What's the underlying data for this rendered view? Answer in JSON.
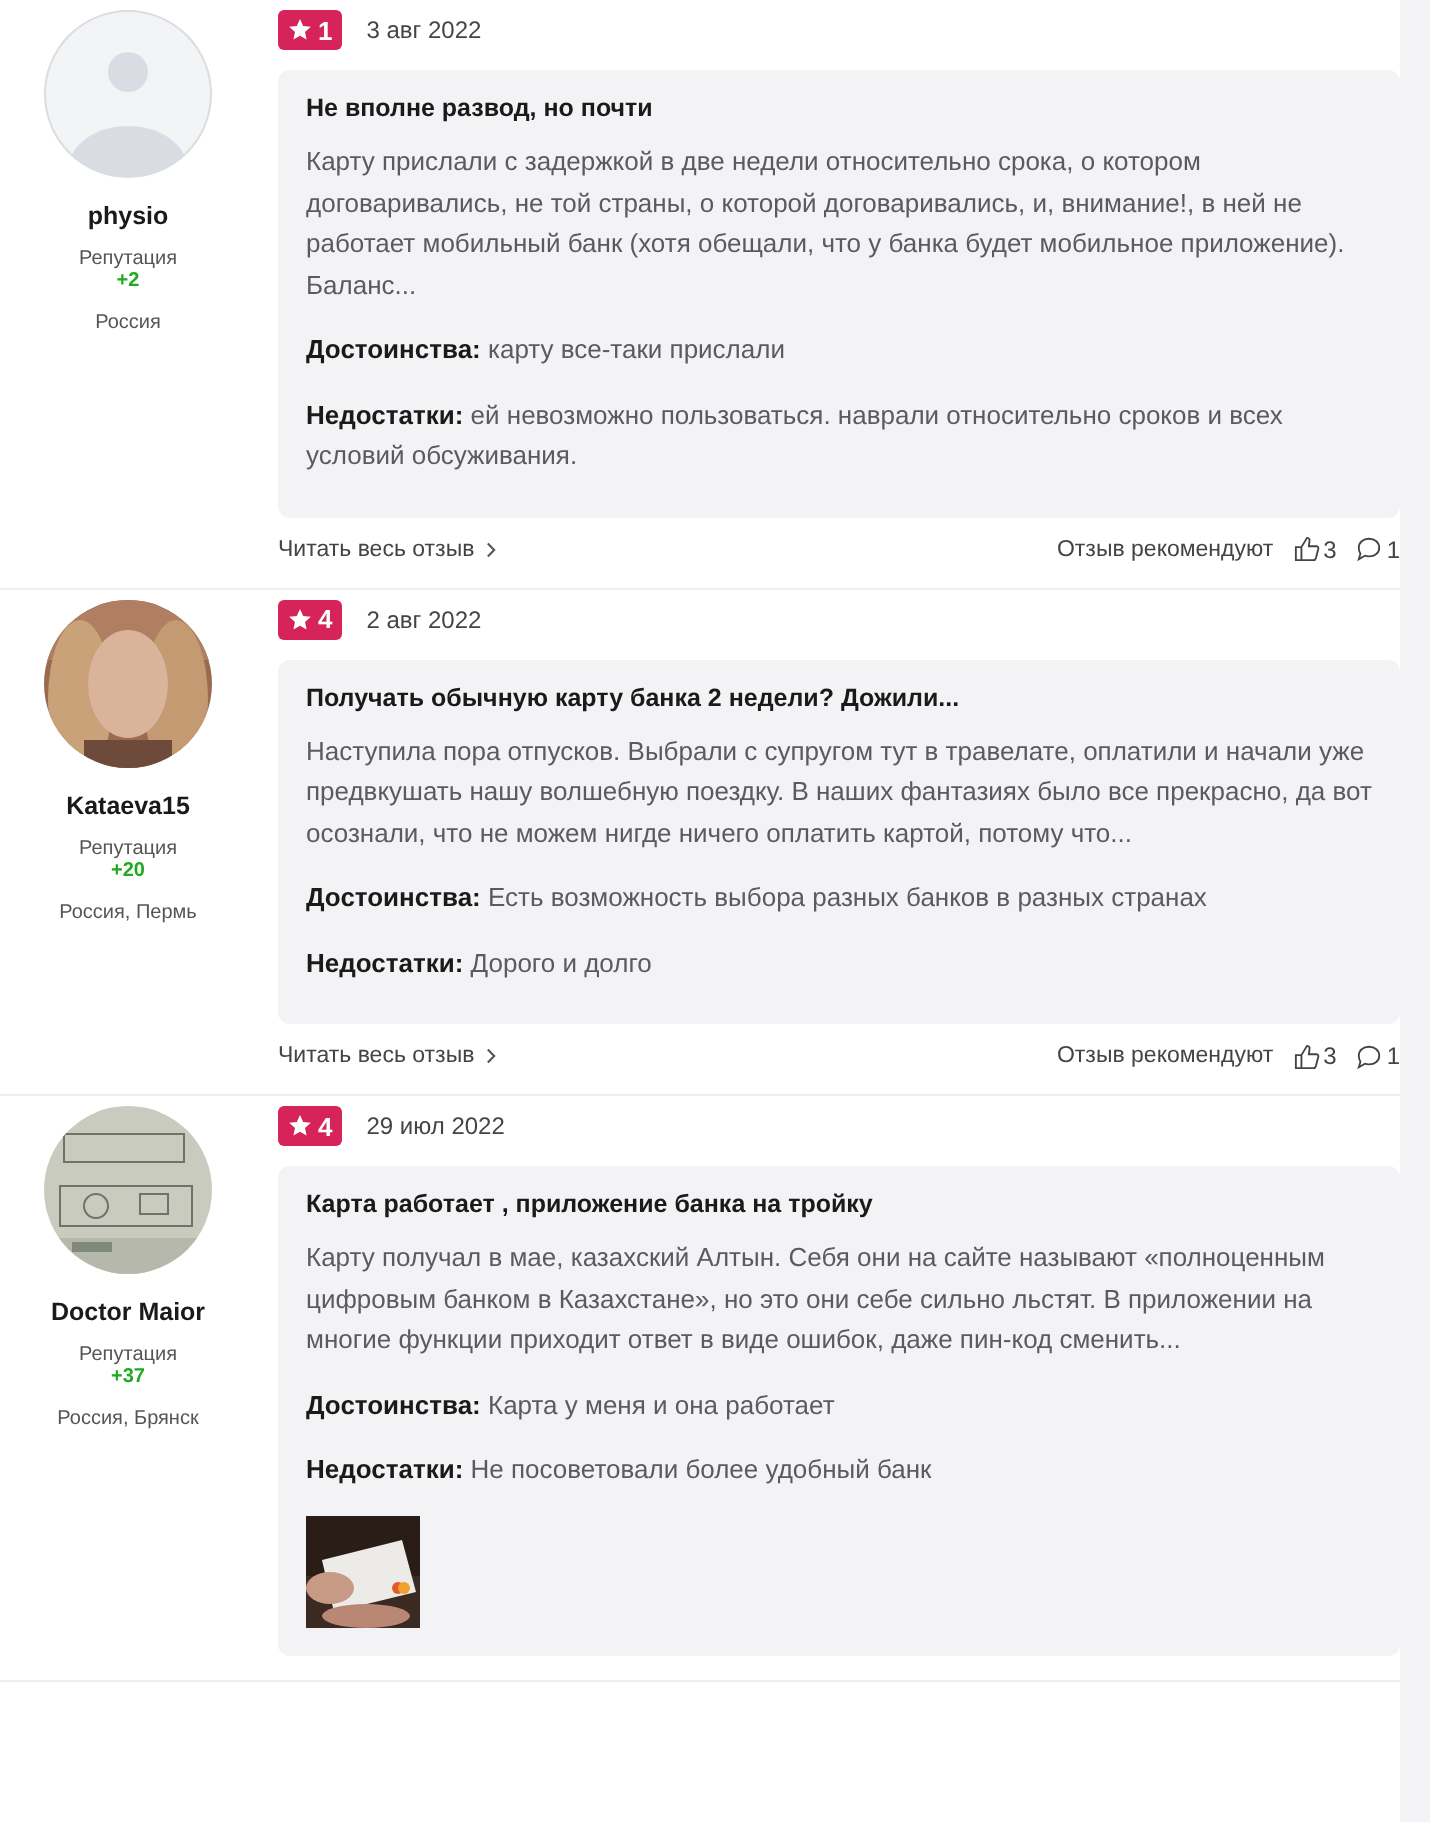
{
  "reviews": [
    {
      "author": {
        "name": "physio",
        "avatar": {
          "kind": "default"
        },
        "reputation_label": "Репутация",
        "reputation": "+2",
        "location": "Россия"
      },
      "rating": "1",
      "date": "3 авг 2022",
      "title": "Не вполне развод, но почти",
      "text": "Карту прислали с задержкой в две недели относительно срока, о котором договаривались, не той страны, о которой договаривались, и, внимание!, в ней не работает мобильный банк (хотя обещали, что у банка будет мобильное приложение). Баланс...",
      "pros_label": "Достоинства:",
      "pros": "карту все-таки прислали",
      "cons_label": "Недостатки:",
      "cons": "ей невозможно пользоваться. наврали относительно сроков и всех условий обсуживания.",
      "footer": {
        "read_more": "Читать весь отзыв",
        "recommend": "Отзыв рекомендуют",
        "likes": "3",
        "comments": "1"
      }
    },
    {
      "author": {
        "name": "Kataeva15",
        "avatar": {
          "kind": "person_photo"
        },
        "reputation_label": "Репутация",
        "reputation": "+20",
        "location": "Россия, Пермь"
      },
      "rating": "4",
      "date": "2 авг 2022",
      "title": "Получать обычную карту банка 2 недели? Дожили...",
      "text": "Наступила пора отпусков. Выбрали с супругом тут в травелате, оплатили и начали уже предвкушать нашу волшебную поездку. В наших фантазиях было все прекрасно, да вот осознали, что не можем нигде ничего оплатить картой, потому что...",
      "pros_label": "Достоинства:",
      "pros": "Есть возможность выбора разных банков в разных странах",
      "cons_label": "Недостатки:",
      "cons": "Дорого и долго",
      "footer": {
        "read_more": "Читать весь отзыв",
        "recommend": "Отзыв рекомендуют",
        "likes": "3",
        "comments": "1"
      }
    },
    {
      "author": {
        "name": "Doctor Maior",
        "avatar": {
          "kind": "sketch_photo"
        },
        "reputation_label": "Репутация",
        "reputation": "+37",
        "location": "Россия, Брянск"
      },
      "rating": "4",
      "date": "29 июл 2022",
      "title": "Карта работает , приложение банка на тройку",
      "text": "Карту получал в мае, казахский Алтын. Себя они на сайте называют «полноценным цифровым банком в Казахстане», но это они себе сильно льстят. В приложении на многие функции приходит ответ в виде ошибок, даже пин-код сменить...",
      "pros_label": "Достоинства:",
      "pros": "Карта у меня и она работает",
      "cons_label": "Недостатки:",
      "cons": "Не посоветовали более удобный банк"
    }
  ]
}
